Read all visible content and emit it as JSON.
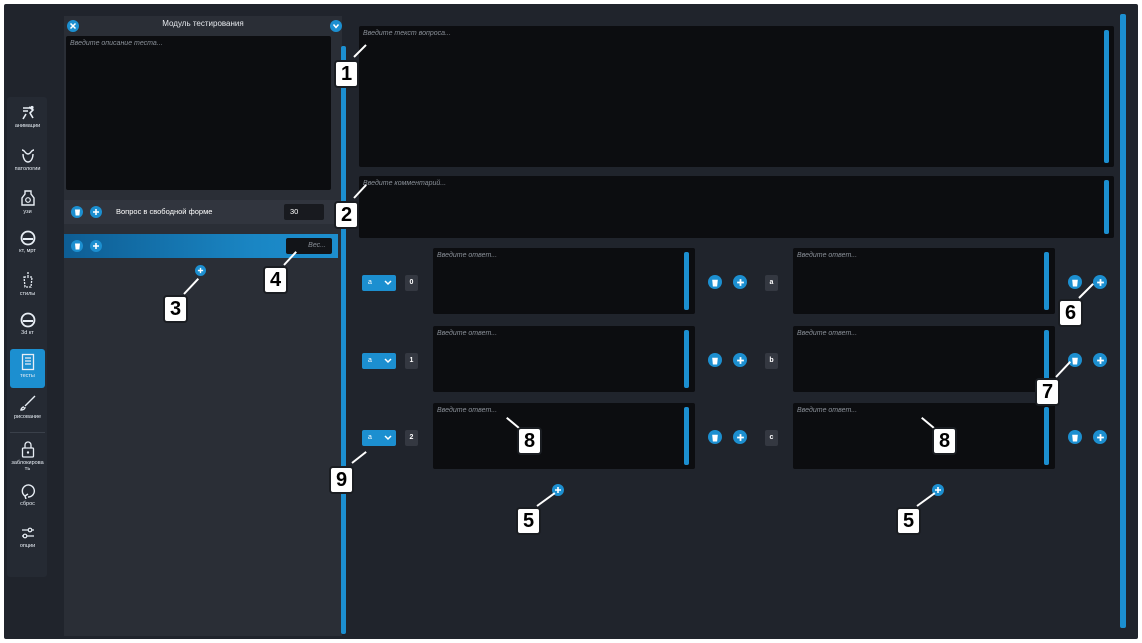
{
  "left_panel": {
    "title": "Модуль тестирования",
    "description_placeholder": "Введите описание теста...",
    "questions": [
      {
        "label": "Вопрос в свободной форме",
        "weight": "30"
      },
      {
        "label": "",
        "weight_placeholder": "Вес..."
      }
    ]
  },
  "toolbar": {
    "items": [
      {
        "label": "анимации",
        "icon": "animation-icon"
      },
      {
        "label": "патологии",
        "icon": "pathology-icon"
      },
      {
        "label": "узи",
        "icon": "ultrasound-icon"
      },
      {
        "label": "кт, мрт",
        "icon": "ct-mri-icon"
      },
      {
        "label": "стилы",
        "icon": "styles-icon"
      },
      {
        "label": "3d кт",
        "icon": "ct3d-icon"
      },
      {
        "label": "тесты",
        "icon": "tests-icon",
        "active": true
      },
      {
        "label": "рисование",
        "icon": "drawing-icon"
      },
      {
        "label": "заблокировать",
        "icon": "lock-icon"
      },
      {
        "label": "сброс",
        "icon": "reset-icon"
      },
      {
        "label": "опции",
        "icon": "options-icon"
      }
    ]
  },
  "question": {
    "text_placeholder": "Введите текст вопроса...",
    "comment_placeholder": "Введите комментарий..."
  },
  "answers_left": [
    {
      "select": "a",
      "index": "0",
      "placeholder": "Введите ответ..."
    },
    {
      "select": "a",
      "index": "1",
      "placeholder": "Введите ответ..."
    },
    {
      "select": "a",
      "index": "2",
      "placeholder": "Введите ответ..."
    }
  ],
  "answers_right": [
    {
      "letter": "a",
      "placeholder": "Введите ответ..."
    },
    {
      "letter": "b",
      "placeholder": "Введите ответ..."
    },
    {
      "letter": "c",
      "placeholder": "Введите ответ..."
    }
  ],
  "callouts": [
    "1",
    "2",
    "3",
    "4",
    "5",
    "5",
    "6",
    "7",
    "8",
    "8",
    "9"
  ],
  "colors": {
    "accent": "#1c8fd0",
    "background": "#20242c",
    "panel": "#2a2e36",
    "field": "#0c0d10"
  }
}
